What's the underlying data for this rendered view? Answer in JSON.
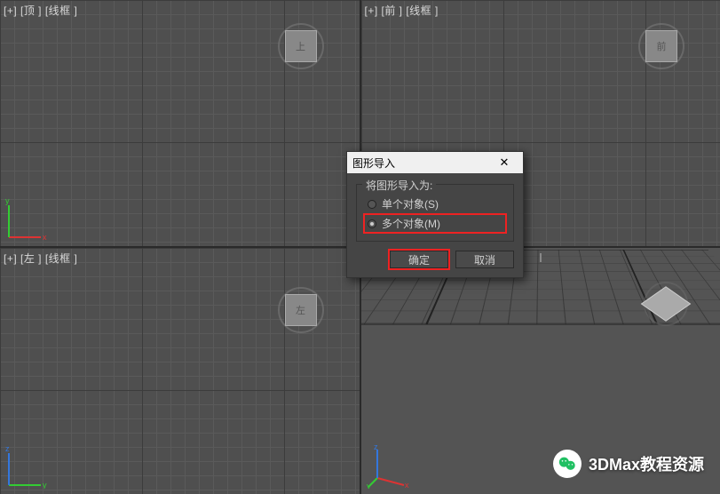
{
  "viewports": {
    "top": {
      "label": "[+] [顶 ] [线框 ]",
      "cube": "上"
    },
    "front": {
      "label": "[+] [前 ] [线框 ]",
      "cube": "前"
    },
    "left": {
      "label": "[+] [左 ] [线框 ]",
      "cube": "左"
    },
    "persp": {
      "label": ""
    }
  },
  "dialog": {
    "title": "图形导入",
    "group_label": "将图形导入为:",
    "option_single": "单个对象(S)",
    "option_multi": "多个对象(M)",
    "selected": "multi",
    "ok": "确定",
    "cancel": "取消"
  },
  "watermark": {
    "text": "3DMax教程资源"
  },
  "colors": {
    "highlight": "#e22222"
  }
}
